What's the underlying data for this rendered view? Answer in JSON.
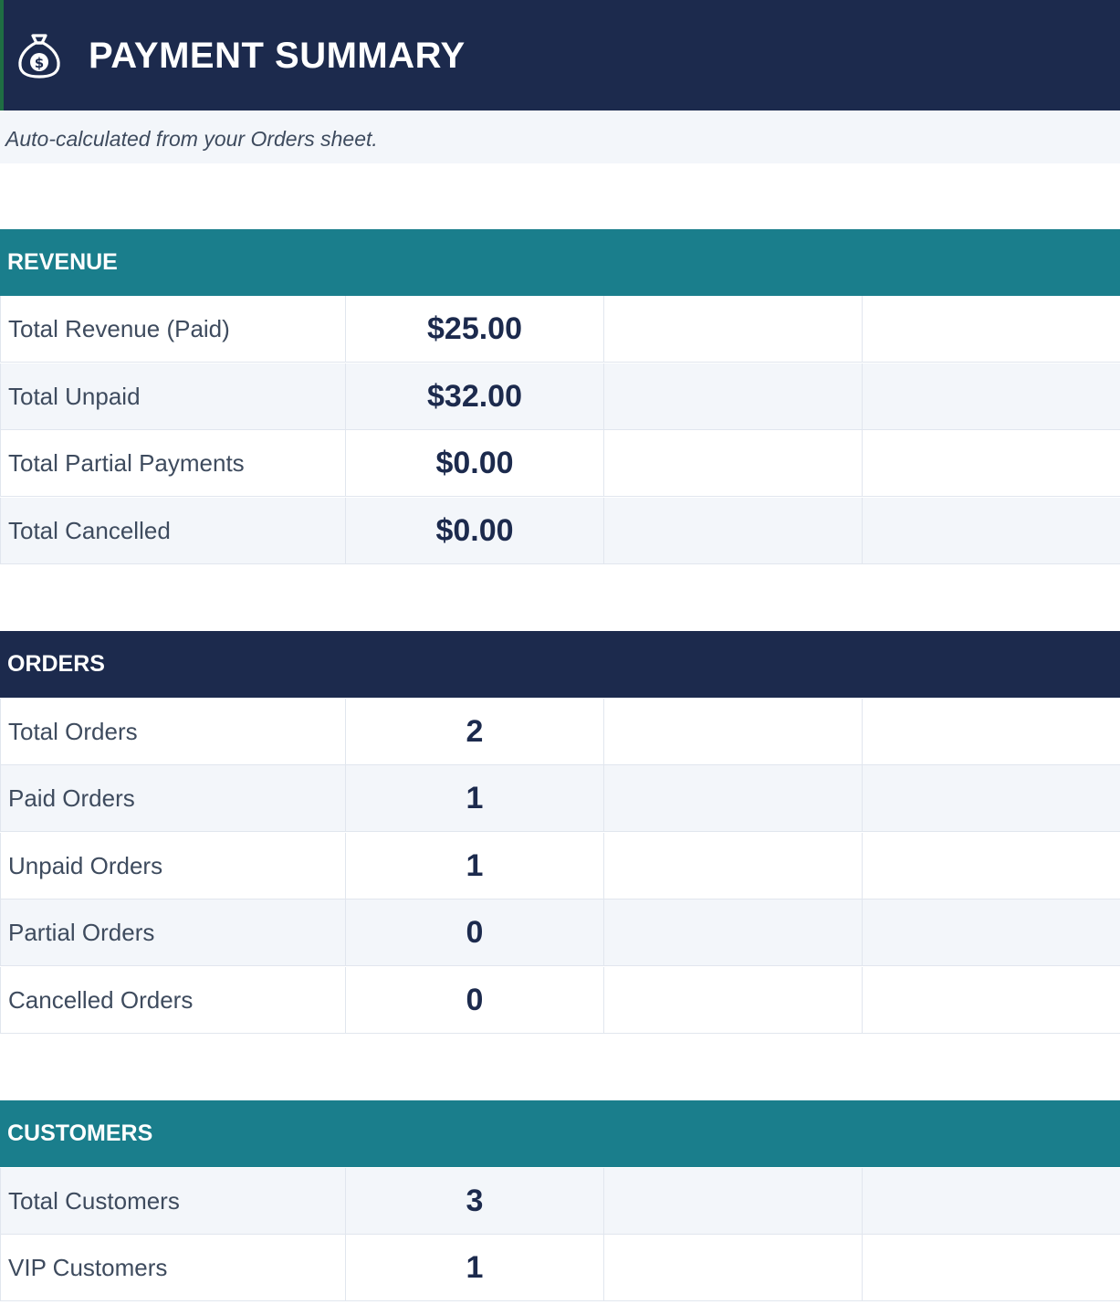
{
  "title": "PAYMENT SUMMARY",
  "title_icon": "money-bag-icon",
  "subtitle": "Auto-calculated from your Orders sheet.",
  "colors": {
    "navy": "#1c2a4d",
    "teal": "#1a7e8c",
    "row_alt": "#f3f6fa"
  },
  "revenue": {
    "header": "REVENUE",
    "rows": [
      {
        "label": "Total Revenue (Paid)",
        "value": "$25.00"
      },
      {
        "label": "Total Unpaid",
        "value": "$32.00"
      },
      {
        "label": "Total Partial Payments",
        "value": "$0.00"
      },
      {
        "label": "Total Cancelled",
        "value": "$0.00"
      }
    ]
  },
  "orders": {
    "header": "ORDERS",
    "rows": [
      {
        "label": "Total Orders",
        "value": "2"
      },
      {
        "label": "Paid Orders",
        "value": "1"
      },
      {
        "label": "Unpaid Orders",
        "value": "1"
      },
      {
        "label": "Partial Orders",
        "value": "0"
      },
      {
        "label": "Cancelled Orders",
        "value": "0"
      }
    ]
  },
  "customers": {
    "header": "CUSTOMERS",
    "rows": [
      {
        "label": "Total Customers",
        "value": "3"
      },
      {
        "label": "VIP Customers",
        "value": "1"
      }
    ]
  }
}
